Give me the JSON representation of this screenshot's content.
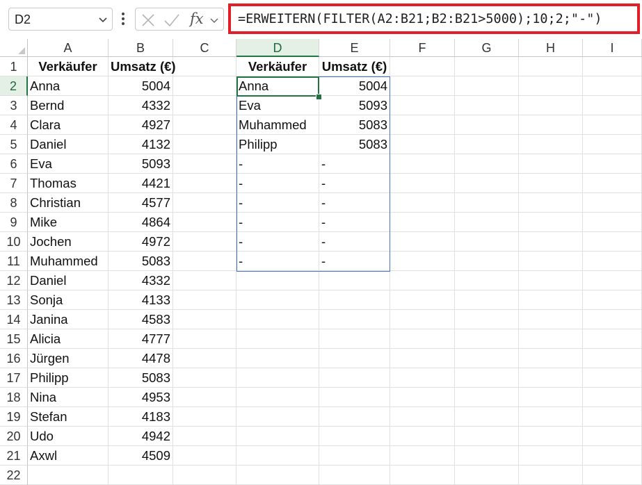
{
  "formula_bar": {
    "name_box": "D2",
    "formula": "=ERWEITERN(FILTER(A2:B21;B2:B21>5000);10;2;\"-\")",
    "fx_label": "fx"
  },
  "columns": [
    "A",
    "B",
    "C",
    "D",
    "E",
    "F",
    "G",
    "H",
    "I"
  ],
  "selected_column": "D",
  "selected_row": 2,
  "rows": [
    {
      "n": "1",
      "a": "Verkäufer",
      "b": "Umsatz (€)",
      "d": "Verkäufer",
      "e": "Umsatz (€)"
    },
    {
      "n": "2",
      "a": "Anna",
      "b": "5004",
      "d": "Anna",
      "e": "5004"
    },
    {
      "n": "3",
      "a": "Bernd",
      "b": "4332",
      "d": "Eva",
      "e": "5093"
    },
    {
      "n": "4",
      "a": "Clara",
      "b": "4927",
      "d": "Muhammed",
      "e": "5083"
    },
    {
      "n": "5",
      "a": "Daniel",
      "b": "4132",
      "d": "Philipp",
      "e": "5083"
    },
    {
      "n": "6",
      "a": "Eva",
      "b": "5093",
      "d": "-",
      "e": "-"
    },
    {
      "n": "7",
      "a": "Thomas",
      "b": "4421",
      "d": "-",
      "e": "-"
    },
    {
      "n": "8",
      "a": "Christian",
      "b": "4577",
      "d": "-",
      "e": "-"
    },
    {
      "n": "9",
      "a": "Mike",
      "b": "4864",
      "d": "-",
      "e": "-"
    },
    {
      "n": "10",
      "a": "Jochen",
      "b": "4972",
      "d": "-",
      "e": "-"
    },
    {
      "n": "11",
      "a": "Muhammed",
      "b": "5083",
      "d": "-",
      "e": "-"
    },
    {
      "n": "12",
      "a": "Daniel",
      "b": "4332",
      "d": "",
      "e": ""
    },
    {
      "n": "13",
      "a": "Sonja",
      "b": "4133",
      "d": "",
      "e": ""
    },
    {
      "n": "14",
      "a": "Janina",
      "b": "4583",
      "d": "",
      "e": ""
    },
    {
      "n": "15",
      "a": "Alicia",
      "b": "4777",
      "d": "",
      "e": ""
    },
    {
      "n": "16",
      "a": "Jürgen",
      "b": "4478",
      "d": "",
      "e": ""
    },
    {
      "n": "17",
      "a": "Philipp",
      "b": "5083",
      "d": "",
      "e": ""
    },
    {
      "n": "18",
      "a": "Nina",
      "b": "4953",
      "d": "",
      "e": ""
    },
    {
      "n": "19",
      "a": "Stefan",
      "b": "4183",
      "d": "",
      "e": ""
    },
    {
      "n": "20",
      "a": "Udo",
      "b": "4942",
      "d": "",
      "e": ""
    },
    {
      "n": "21",
      "a": "Axwl",
      "b": "4509",
      "d": "",
      "e": ""
    },
    {
      "n": "22",
      "a": "",
      "b": "",
      "d": "",
      "e": ""
    }
  ],
  "colors": {
    "accent": "#217346",
    "spill_border": "#4472c4",
    "highlight_box": "#e01f28"
  }
}
